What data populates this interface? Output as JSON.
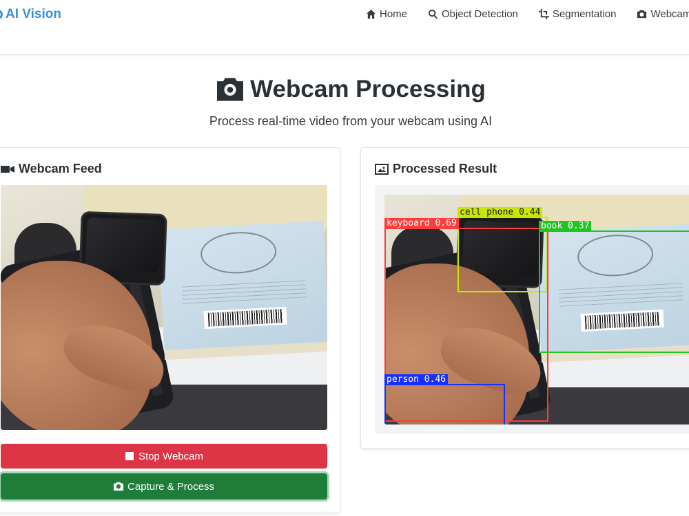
{
  "brand": {
    "label": "AI Vision",
    "color": "#3a8fd9"
  },
  "nav": [
    {
      "label": "Home",
      "icon": "home-icon"
    },
    {
      "label": "Object Detection",
      "icon": "search-icon"
    },
    {
      "label": "Segmentation",
      "icon": "crop-icon"
    },
    {
      "label": "Webcam",
      "icon": "camera-icon"
    }
  ],
  "header": {
    "title": "Webcam Processing",
    "subtitle": "Process real-time video from your webcam using AI"
  },
  "feed_card": {
    "title": "Webcam Feed",
    "stop_label": "Stop Webcam",
    "capture_label": "Capture & Process"
  },
  "result_card": {
    "title": "Processed Result",
    "detections": [
      {
        "label": "cell phone",
        "score": "0.44",
        "text": "cell phone 0.44",
        "color": "#c8e600"
      },
      {
        "label": "keyboard",
        "score": "0.69",
        "text": "keyboard 0.69",
        "color": "#ff3b3b"
      },
      {
        "label": "book",
        "score": "0.37",
        "text": "book 0.37",
        "color": "#22c322"
      },
      {
        "label": "person",
        "score": "0.46",
        "text": "person 0.46",
        "color": "#1a2fff"
      }
    ]
  },
  "colors": {
    "stop_button": "#dc3545",
    "capture_button": "#1f7d3a"
  }
}
